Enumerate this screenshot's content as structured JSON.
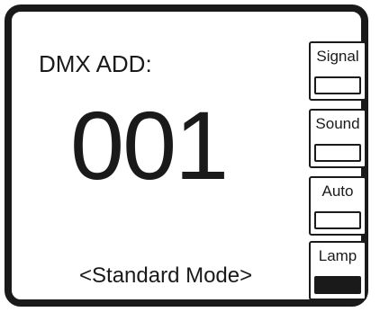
{
  "display": {
    "address_label": "DMX ADD:",
    "address_value": "001",
    "mode_text": "<Standard Mode>"
  },
  "indicators": [
    {
      "label": "Signal",
      "on": false
    },
    {
      "label": "Sound",
      "on": false
    },
    {
      "label": "Auto",
      "on": false
    },
    {
      "label": "Lamp",
      "on": true
    }
  ],
  "colors": {
    "foreground": "#1a1a1a",
    "background": "#ffffff"
  }
}
